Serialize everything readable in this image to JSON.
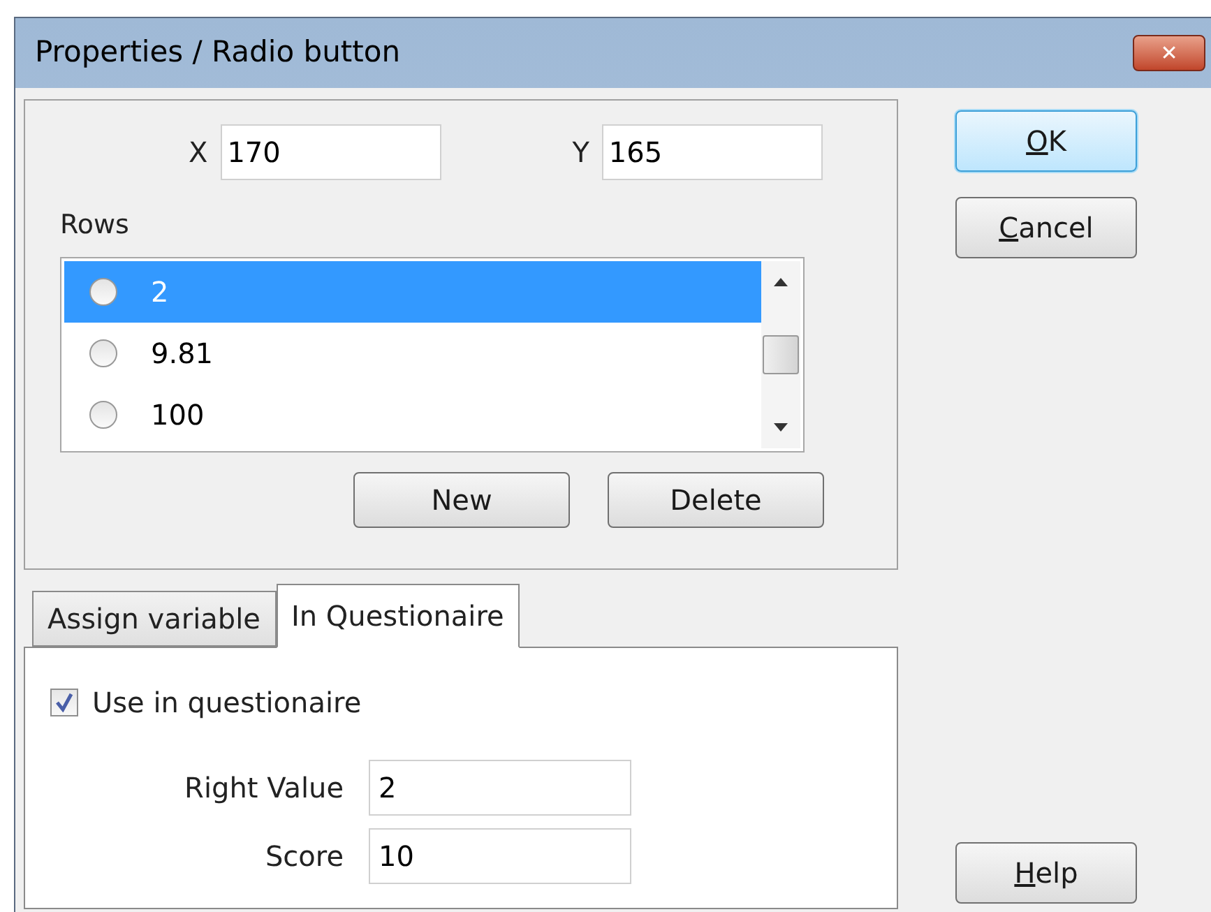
{
  "window": {
    "title": "Properties / Radio button",
    "close": "✕"
  },
  "position": [
    {
      "label": "X",
      "value": "170"
    },
    {
      "label": "Y",
      "value": "165"
    }
  ],
  "rows": {
    "label": "Rows",
    "items": [
      {
        "text": "2",
        "selected": true,
        "checked": false
      },
      {
        "text": "9.81",
        "selected": false,
        "checked": false
      },
      {
        "text": "100",
        "selected": false,
        "checked": false
      }
    ]
  },
  "row_buttons": [
    "New",
    "Delete"
  ],
  "tabs": [
    {
      "label": "Assign variable",
      "selected": false
    },
    {
      "label": "In Questionaire",
      "selected": true
    }
  ],
  "questionaire": {
    "use": {
      "label": "Use in questionaire",
      "checked": true
    },
    "fields": [
      {
        "label": "Right Value",
        "value": "2"
      },
      {
        "label": "Score",
        "value": "10"
      }
    ]
  },
  "dialog_buttons": [
    {
      "label": "OK",
      "access_key": true,
      "default": true
    },
    {
      "label": "Cancel",
      "access_key": true,
      "default": false
    }
  ],
  "help_button": {
    "label": "Help",
    "access_key": true
  }
}
